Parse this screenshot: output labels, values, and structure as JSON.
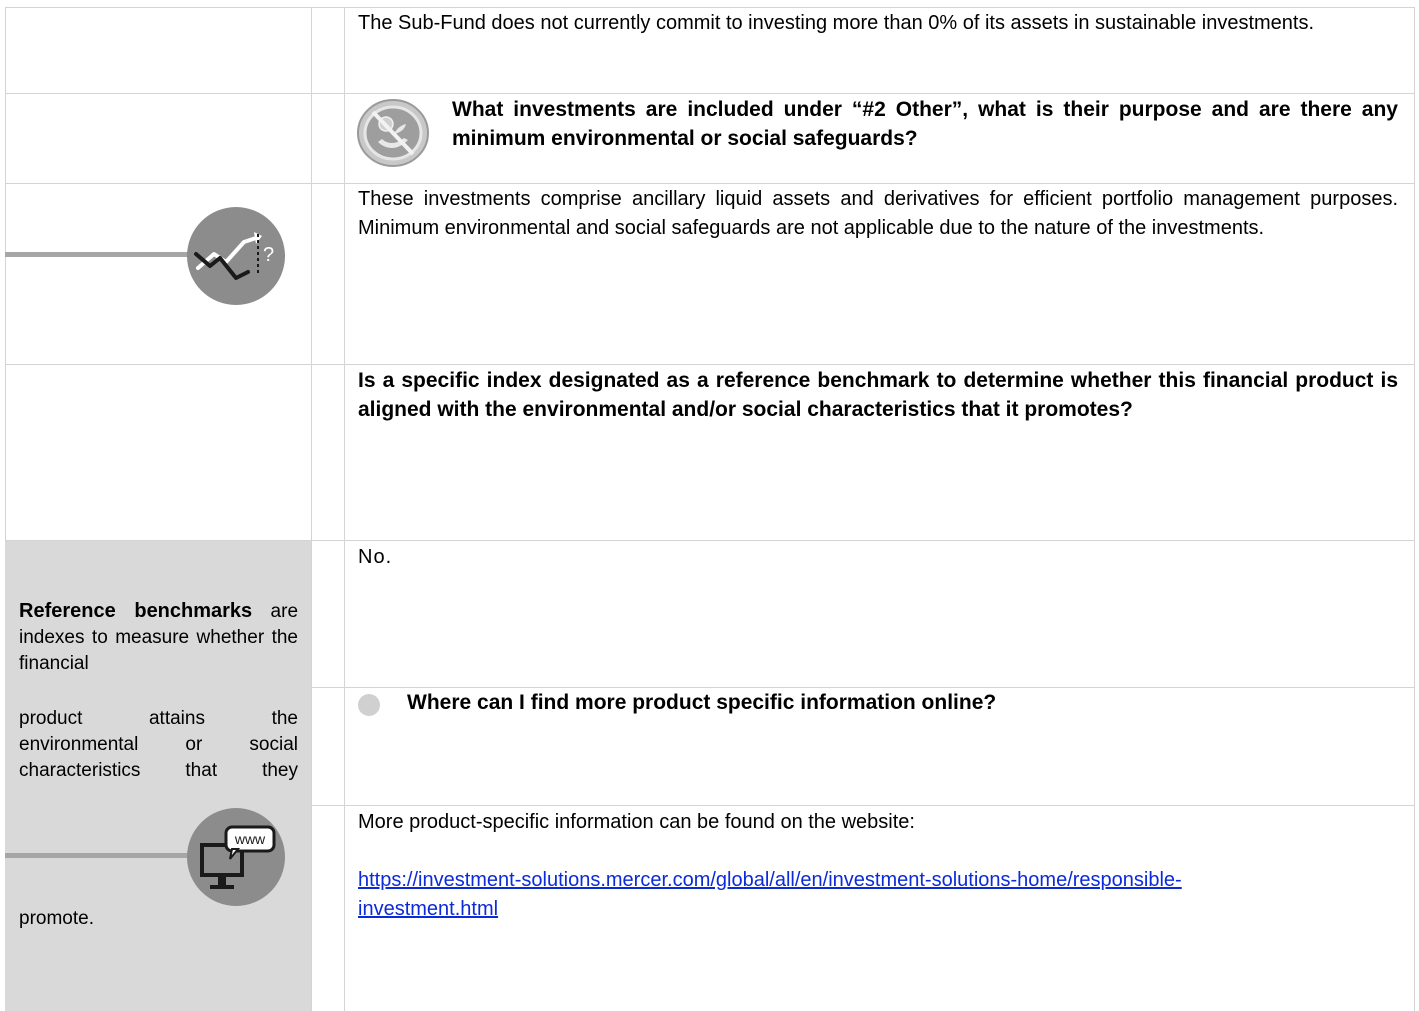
{
  "rows": {
    "sustainable_text": "The Sub-Fund does not currently commit to investing more than 0% of its assets in sustainable investments.",
    "other_question": "What investments are included under “#2 Other”, what is their purpose and are there any minimum environmental or social safeguards?",
    "other_answer": "These investments comprise ancillary liquid assets and derivatives for efficient portfolio management purposes. Minimum environmental and social safeguards are not applicable due to the nature of the investments.",
    "benchmark_question": "Is a specific index designated as a reference benchmark to determine whether this financial product is aligned with the environmental and/or social characteristics that it promotes?",
    "benchmark_answer": "No.",
    "online_question": "Where can I find more product specific information online?",
    "online_intro": "More product-specific information can be found on the website:",
    "online_link_line1": "https://investment-solutions.mercer.com/global/all/en/investment-solutions-home/responsible-",
    "online_link_line2": "investment.html"
  },
  "sidebar": {
    "term": "Reference benchmarks",
    "def_part1": "are indexes to measure whether the financial",
    "def_part2": "product attains the environmental or social characteristics that they",
    "def_part3": "promote.",
    "www_label": "www",
    "chart_question_mark": "?"
  },
  "icons": {
    "other": "no-environment-icon",
    "trend": "trend-question-icon",
    "www": "computer-www-icon",
    "bullet": "bullet-dot-icon"
  },
  "colors": {
    "panel": "#d9d9d9",
    "icon_gray": "#8c8c8c",
    "link": "#0b2ad8"
  }
}
